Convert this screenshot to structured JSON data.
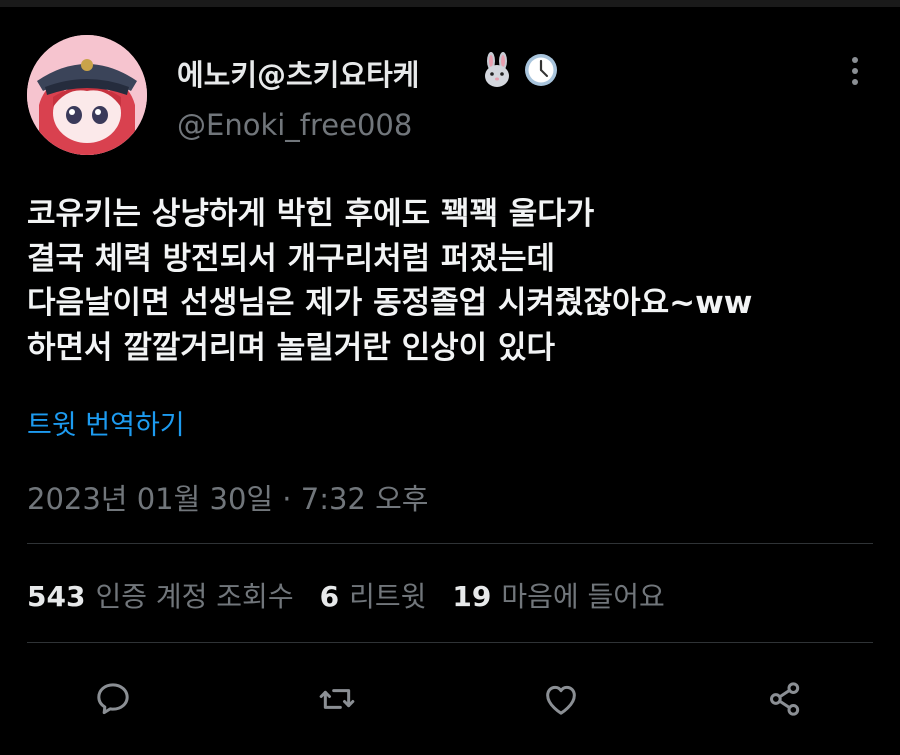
{
  "author": {
    "display_name": "에노키@츠키요타케",
    "handle": "@Enoki_free008",
    "badges": [
      "rabbit-emoji",
      "clock-emoji"
    ]
  },
  "tweet": {
    "lines": [
      "코유키는 상냥하게 박힌 후에도 꽥꽥 울다가",
      "결국 체력 방전되서 개구리처럼 퍼졌는데",
      "다음날이면 선생님은 제가 동정졸업 시켜줬잖아요~ww",
      "하면서 깔깔거리며 놀릴거란 인상이 있다"
    ],
    "translate_label": "트윗 번역하기",
    "timestamp": "2023년 01월 30일 · 7:32 오후"
  },
  "stats": {
    "views_count": "543",
    "views_label": "인증 계정 조회수",
    "retweets_count": "6",
    "retweets_label": "리트윗",
    "likes_count": "19",
    "likes_label": "마음에 들어요"
  },
  "actions": [
    "reply-icon",
    "retweet-icon",
    "like-icon",
    "share-icon"
  ],
  "colors": {
    "background": "#000000",
    "text": "#e7e9ea",
    "muted": "#71767b",
    "link": "#1d9bf0",
    "divider": "#2f3336"
  }
}
